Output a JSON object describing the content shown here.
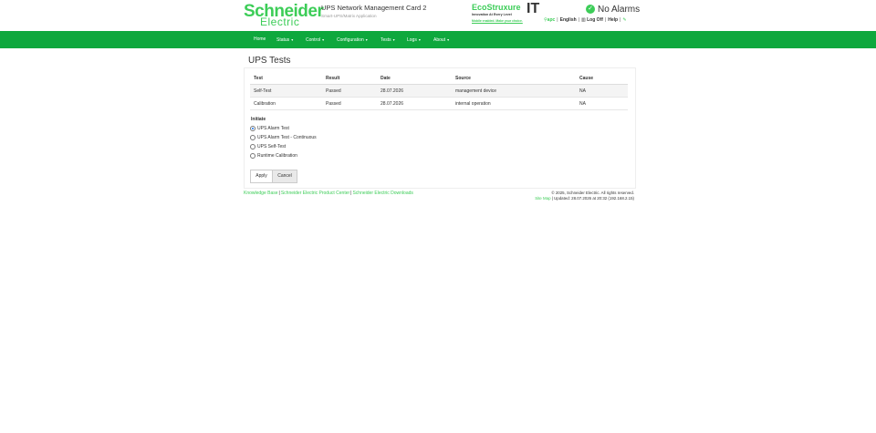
{
  "header": {
    "logo_line1": "Schneider",
    "logo_line2": "Electric",
    "product_title": "UPS Network Management Card 2",
    "product_subtitle": "Smart-UPS/Matrix Application",
    "eco_brand": "EcoStruxure",
    "eco_tagline": "Innovation At Every Level",
    "eco_link": "Mobile enabled. Make your choice.",
    "eco_it": "IT",
    "alarm_status": "No Alarms",
    "user": "apc",
    "language": "English",
    "logoff": "Log Off",
    "help": "Help"
  },
  "nav": {
    "items": [
      {
        "label": "Home",
        "dropdown": false
      },
      {
        "label": "Status",
        "dropdown": true
      },
      {
        "label": "Control",
        "dropdown": true
      },
      {
        "label": "Configuration",
        "dropdown": true
      },
      {
        "label": "Tests",
        "dropdown": true
      },
      {
        "label": "Logs",
        "dropdown": true
      },
      {
        "label": "About",
        "dropdown": true
      }
    ],
    "caret": "▾"
  },
  "main": {
    "title": "UPS Tests",
    "table": {
      "headers": [
        "Test",
        "Result",
        "Date",
        "Source",
        "Cause"
      ],
      "rows": [
        [
          "Self-Test",
          "Passed",
          "28.07.2026",
          "management device",
          "NA"
        ],
        [
          "Calibration",
          "Passed",
          "28.07.2026",
          "internal operation",
          "NA"
        ]
      ]
    },
    "initiate_label": "Initiate",
    "options": [
      {
        "label": "UPS Alarm Test",
        "selected": true
      },
      {
        "label": "UPS Alarm Test - Continuous",
        "selected": false
      },
      {
        "label": "UPS Self-Test",
        "selected": false
      },
      {
        "label": "Runtime Calibration",
        "selected": false
      }
    ],
    "apply_label": "Apply",
    "cancel_label": "Cancel"
  },
  "footer": {
    "links": [
      "Knowledge Base",
      "Schneider Electric Product Center",
      "Schneider Electric Downloads"
    ],
    "copyright": "© 2025, Schneider Electric. All rights reserved.",
    "site_map": "Site Map",
    "updated": "| Updated: 28.07.2026 at 20:32 (192.168.2.15)"
  },
  "colors": {
    "brand_green": "#3dcd58",
    "nav_green": "#0ea83d"
  }
}
